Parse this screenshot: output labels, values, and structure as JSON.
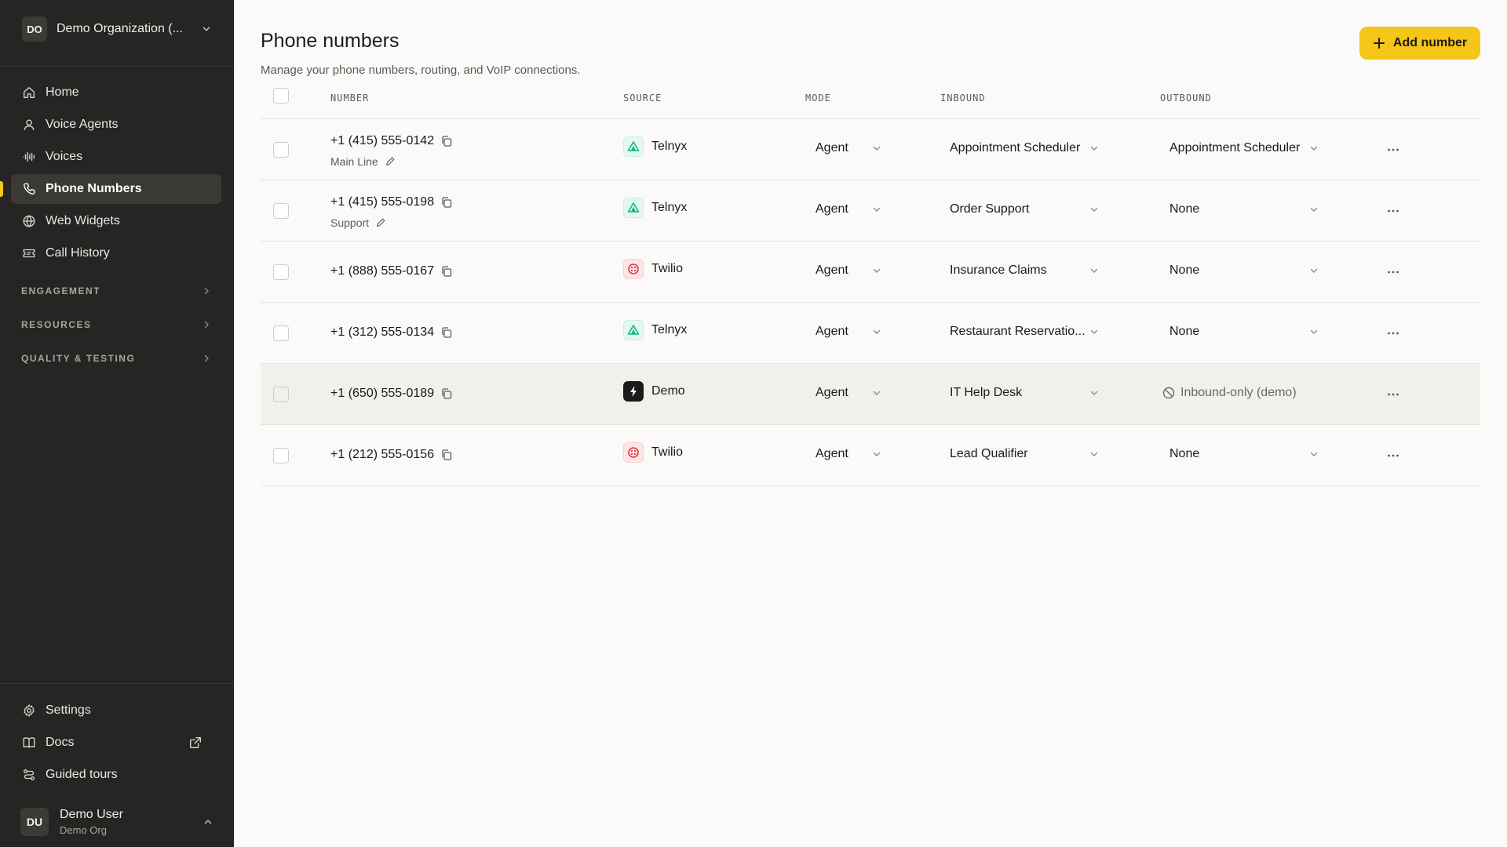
{
  "sidebar": {
    "org_initials": "DO",
    "org_name": "Demo Organization (...",
    "nav": [
      {
        "label": "Home",
        "icon": "home-icon"
      },
      {
        "label": "Voice Agents",
        "icon": "user-icon"
      },
      {
        "label": "Voices",
        "icon": "waveform-icon"
      },
      {
        "label": "Phone Numbers",
        "icon": "phone-icon",
        "active": true
      },
      {
        "label": "Web Widgets",
        "icon": "globe-icon"
      },
      {
        "label": "Call History",
        "icon": "ticket-icon"
      }
    ],
    "sections": [
      "ENGAGEMENT",
      "RESOURCES",
      "QUALITY & TESTING"
    ],
    "bottom_nav": [
      {
        "label": "Settings",
        "icon": "gear-icon"
      },
      {
        "label": "Docs",
        "icon": "book-icon"
      },
      {
        "label": "Guided tours",
        "icon": "route-icon"
      }
    ],
    "user": {
      "initials": "DU",
      "name": "Demo User",
      "org": "Demo Org"
    }
  },
  "header": {
    "title": "Phone numbers",
    "subtitle": "Manage your phone numbers, routing, and VoIP connections.",
    "add_button": "Add number"
  },
  "table": {
    "columns": [
      "NUMBER",
      "SOURCE",
      "MODE",
      "INBOUND",
      "OUTBOUND"
    ],
    "rows": [
      {
        "number": "+1 (415) 555-0142",
        "label": "Main Line",
        "source": "Telnyx",
        "mode": "Agent",
        "inbound": "Appointment Scheduler",
        "outbound": "Appointment Scheduler"
      },
      {
        "number": "+1 (415) 555-0198",
        "label": "Support",
        "source": "Telnyx",
        "mode": "Agent",
        "inbound": "Order Support",
        "outbound": "None"
      },
      {
        "number": "+1 (888) 555-0167",
        "label": "",
        "source": "Twilio",
        "mode": "Agent",
        "inbound": "Insurance Claims",
        "outbound": "None"
      },
      {
        "number": "+1 (312) 555-0134",
        "label": "",
        "source": "Telnyx",
        "mode": "Agent",
        "inbound": "Restaurant Reservatio...",
        "outbound": "None"
      },
      {
        "number": "+1 (650) 555-0189",
        "label": "",
        "source": "Demo",
        "mode": "Agent",
        "inbound": "IT Help Desk",
        "outbound": "Inbound-only (demo)"
      },
      {
        "number": "+1 (212) 555-0156",
        "label": "",
        "source": "Twilio",
        "mode": "Agent",
        "inbound": "Lead Qualifier",
        "outbound": "None"
      }
    ]
  },
  "colors": {
    "accent": "#f5c518",
    "sidebar_bg": "#262523",
    "telnyx": "#10b981",
    "twilio": "#e3343e"
  }
}
